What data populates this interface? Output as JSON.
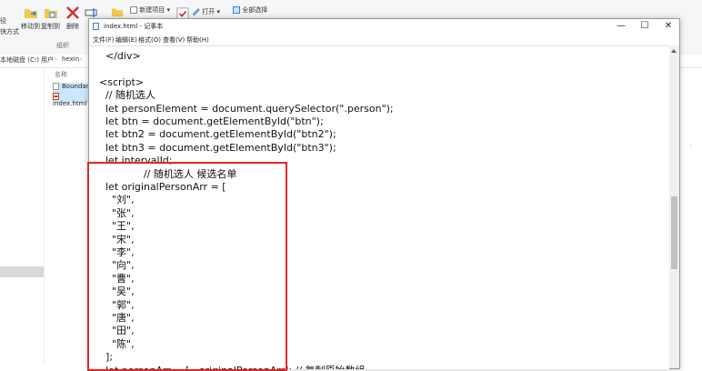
{
  "explorer": {
    "ribbon": {
      "left_partial_top": "径",
      "left_partial_bottom": "快方式",
      "move_to": "移动到",
      "copy_to": "复制到",
      "delete": "删除",
      "rename_partial": "重",
      "new_item": "新建项目",
      "open": "打开",
      "select_all": "全部选择",
      "group_organize": "组织"
    },
    "breadcrumb": [
      "本地磁盘 (C:)",
      "用户",
      "hexin"
    ],
    "column_name": "名称",
    "files": [
      {
        "name": "Boundary"
      },
      {
        "name": "index.html"
      }
    ]
  },
  "notepad": {
    "title": "index.html - 记事本",
    "menu": [
      "文件(F)",
      "编辑(E)",
      "格式(O)",
      "查看(V)",
      "帮助(H)"
    ],
    "window_buttons": {
      "minimize": "—",
      "maximize": "☐",
      "close": "✕"
    },
    "lines": [
      "  </div>",
      "",
      "<script>",
      "  // 随机选人",
      "  let personElement = document.querySelector(\".person\");",
      "  let btn = document.getElementById(\"btn\");",
      "  let btn2 = document.getElementById(\"btn2\");",
      "  let btn3 = document.getElementById(\"btn3\");",
      "  let intervalId;",
      "              // 随机选人 候选名单",
      "  let originalPersonArr = [",
      "    \"刘\",",
      "    \"张\",",
      "    \"王\",",
      "    \"宋\",",
      "    \"李\",",
      "    \"向\",",
      "    \"曹\",",
      "    \"吴\",",
      "    \"郭\",",
      "    \"唐\",",
      "    \"田\",",
      "    \"陈\",",
      "  ];",
      "  let personArr = [...originalPersonArr]; // 复制原始数组"
    ]
  },
  "colors": {
    "highlight": "#e0262b",
    "selection": "#cce8ff"
  }
}
